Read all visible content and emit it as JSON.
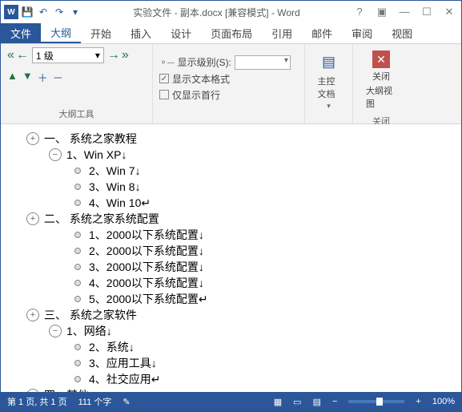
{
  "titlebar": {
    "title": "实验文件 - 副本.docx [兼容模式] - Word"
  },
  "tabs": {
    "file": "文件",
    "outline": "大纲",
    "home": "开始",
    "insert": "插入",
    "design": "设计",
    "layout": "页面布局",
    "references": "引用",
    "mail": "邮件",
    "review": "审阅",
    "view": "视图"
  },
  "ribbon": {
    "level_value": "1 级",
    "show_level_label": "显示级别(S):",
    "show_text_formatting": "显示文本格式",
    "show_first_line_only": "仅显示首行",
    "outline_tools_label": "大纲工具",
    "master_doc": "主控文档",
    "close_outline_l1": "关闭",
    "close_outline_l2": "大纲视图",
    "close_label": "关闭"
  },
  "outline": [
    {
      "indent": 0,
      "icon": "plus",
      "text": "一、 系统之家教程"
    },
    {
      "indent": 1,
      "icon": "minus",
      "text": "1、Win XP↓"
    },
    {
      "indent": 2,
      "icon": "dot",
      "text": "2、Win 7↓"
    },
    {
      "indent": 2,
      "icon": "dot",
      "text": "3、Win 8↓"
    },
    {
      "indent": 2,
      "icon": "dot",
      "text": "4、Win 10↵"
    },
    {
      "indent": 0,
      "icon": "plus",
      "text": "二、 系统之家系统配置"
    },
    {
      "indent": 2,
      "icon": "dot",
      "text": "1、2000以下系统配置↓"
    },
    {
      "indent": 2,
      "icon": "dot",
      "text": "2、2000以下系统配置↓"
    },
    {
      "indent": 2,
      "icon": "dot",
      "text": "3、2000以下系统配置↓"
    },
    {
      "indent": 2,
      "icon": "dot",
      "text": "4、2000以下系统配置↓"
    },
    {
      "indent": 2,
      "icon": "dot",
      "text": "5、2000以下系统配置↵"
    },
    {
      "indent": 0,
      "icon": "plus",
      "text": "三、 系统之家软件"
    },
    {
      "indent": 1,
      "icon": "minus",
      "text": "1、网络↓"
    },
    {
      "indent": 2,
      "icon": "dot",
      "text": "2、系统↓"
    },
    {
      "indent": 2,
      "icon": "dot",
      "text": "3、应用工具↓"
    },
    {
      "indent": 2,
      "icon": "dot",
      "text": "4、社交应用↵"
    },
    {
      "indent": 0,
      "icon": "minus",
      "text": "四、其他"
    }
  ],
  "statusbar": {
    "page": "第 1 页, 共 1 页",
    "words": "111 个字",
    "zoom": "100%"
  }
}
